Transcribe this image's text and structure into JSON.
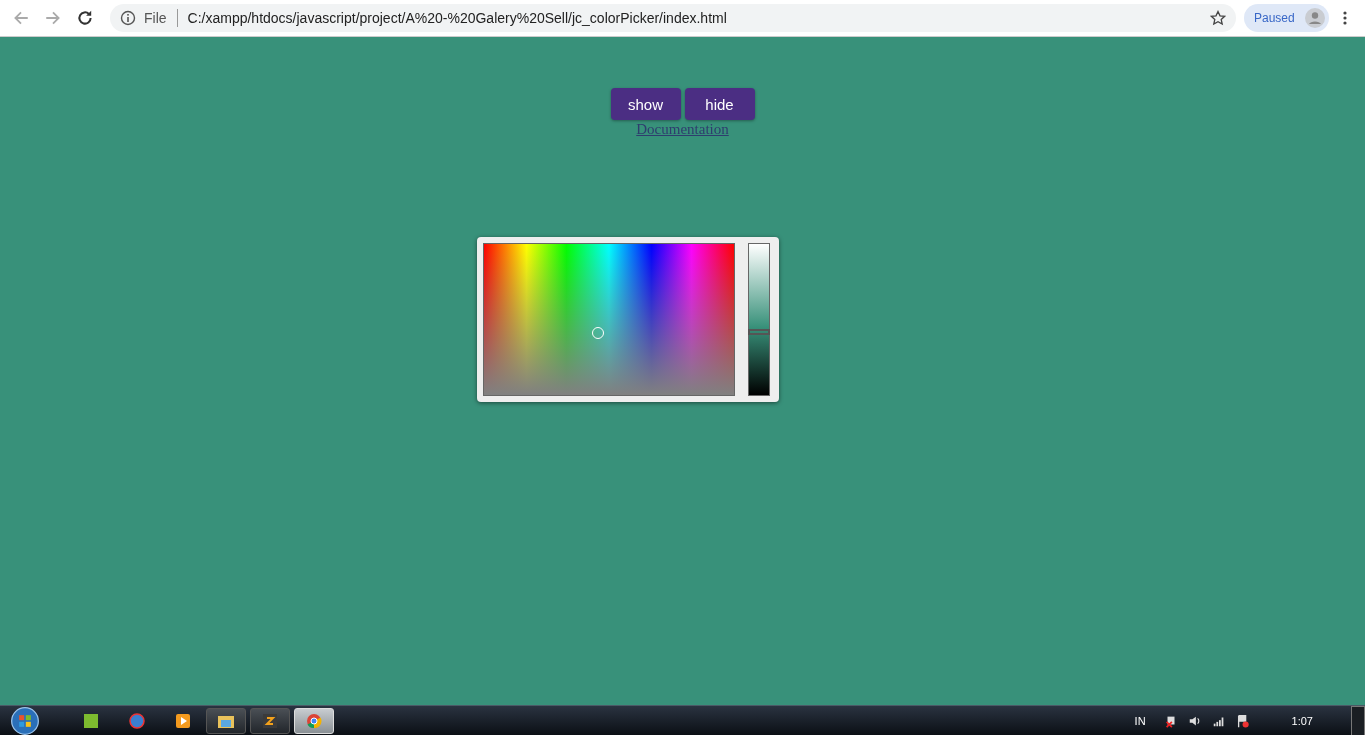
{
  "browser": {
    "scheme_label": "File",
    "url": "C:/xampp/htdocs/javascript/project/A%20-%20Galery%20Sell/jc_colorPicker/index.html",
    "profile_label": "Paused"
  },
  "page": {
    "buttons": [
      "show",
      "hide"
    ],
    "link": "Documentation",
    "picker": {
      "level": 0.42
    }
  },
  "taskbar": {
    "apps": [
      {
        "kind": "pinned"
      },
      {
        "kind": "pinned"
      },
      {
        "kind": "pinned"
      },
      {
        "kind": "window",
        "selected": false
      },
      {
        "kind": "window",
        "selected": false
      },
      {
        "kind": "window",
        "selected": true
      }
    ],
    "language": "IN",
    "time": "1:07"
  }
}
